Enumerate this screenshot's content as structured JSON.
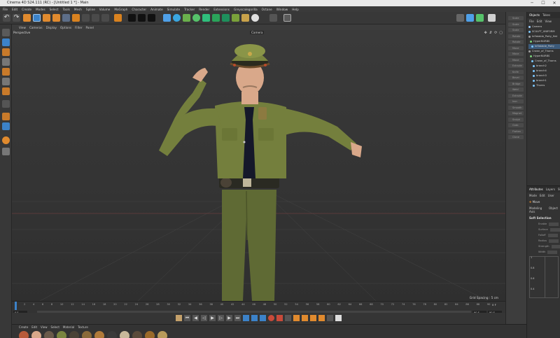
{
  "window": {
    "title": "Cinema 4D S24.111 (RC) - [Untitled 1 *] - Main",
    "minimize": "─",
    "maximize": "☐",
    "close": "✕"
  },
  "menu": [
    "File",
    "Edit",
    "Create",
    "Modes",
    "Select",
    "Tools",
    "Mesh",
    "Spline",
    "Volume",
    "MoGraph",
    "Character",
    "Animate",
    "Simulate",
    "Tracker",
    "Render",
    "Extensions",
    "Greyscalegorilla",
    "Octane",
    "Window",
    "Help"
  ],
  "viewport": {
    "menu": [
      "View",
      "Cameras",
      "Display",
      "Options",
      "Filter",
      "Panel"
    ],
    "label": "Perspective",
    "camera": "Camera",
    "grid_spacing": "Grid Spacing : 5 cm"
  },
  "timeline": {
    "ticks": [
      "0",
      "2",
      "4",
      "6",
      "8",
      "10",
      "12",
      "14",
      "16",
      "18",
      "20",
      "22",
      "24",
      "26",
      "28",
      "30",
      "32",
      "34",
      "36",
      "38",
      "40",
      "42",
      "44",
      "46",
      "48",
      "50",
      "52",
      "54",
      "56",
      "58",
      "60",
      "62",
      "64",
      "66",
      "68",
      "70",
      "72",
      "74",
      "76",
      "78",
      "80",
      "82",
      "84",
      "86",
      "88",
      "90"
    ],
    "current_frame": "0 F",
    "start_field": "0 F",
    "end_field": "90 F",
    "end_field2": "90 F",
    "right_field": "0 F"
  },
  "materials": {
    "menu": [
      "Create",
      "Edit",
      "View",
      "Select",
      "Material",
      "Texture"
    ]
  },
  "right_strip": [
    "Scale",
    "Scale",
    "Scale",
    "Rotate",
    "Rotate",
    "Move",
    "Move",
    "Move",
    "Extrude",
    "Knife",
    "Bevel",
    "Bridge",
    "Weld",
    "Extrude",
    "Iron",
    "Smooth",
    "Magnet",
    "Sculpt",
    "Grab",
    "Flatten",
    "Clone"
  ],
  "objects_panel": {
    "tabs": [
      "Objects",
      "Takes"
    ],
    "menu": [
      "File",
      "Edit",
      "View"
    ],
    "rows": [
      {
        "name": "Camera",
        "color": "#9fd0ff"
      },
      {
        "name": "SCULPT_UNIFORM",
        "color": "#7ec8ff"
      },
      {
        "name": "Inflatable_Party_Hat",
        "color": "#a0a0a0"
      },
      {
        "name": "HyperNURBS",
        "color": "#7ad17a"
      },
      {
        "name": "Inflatable_Party",
        "color": "#7ec8ff"
      },
      {
        "name": "Crown_of_Thorns",
        "color": "#a0a0a0"
      },
      {
        "name": "HyperNURBS",
        "color": "#7ad17a"
      },
      {
        "name": "Crown_of_Thorns",
        "color": "#7ec8ff"
      },
      {
        "name": "branch2",
        "color": "#7ec8ff"
      },
      {
        "name": "branch4",
        "color": "#7ec8ff"
      },
      {
        "name": "branch3",
        "color": "#7ec8ff"
      },
      {
        "name": "branch1",
        "color": "#7ec8ff"
      },
      {
        "name": "Thorns",
        "color": "#7ec8ff"
      }
    ]
  },
  "attributes_panel": {
    "tabs": [
      "Attributes",
      "Layers",
      "St"
    ],
    "menu": [
      "Mode",
      "Edit",
      "User"
    ],
    "object": "Move",
    "subtabs": [
      "Modeling Axis",
      "Object"
    ],
    "section": "Soft Selection",
    "rows": [
      "Enable",
      "Surface",
      "Falloff",
      "Radius",
      "Strength",
      "Width"
    ],
    "graph_labels": [
      "1",
      "0.8",
      "0.6",
      "0.4"
    ]
  },
  "colors": {
    "accent": "#f08a24",
    "selected": "#3c82c8",
    "uniform": "#6f7a3a"
  }
}
